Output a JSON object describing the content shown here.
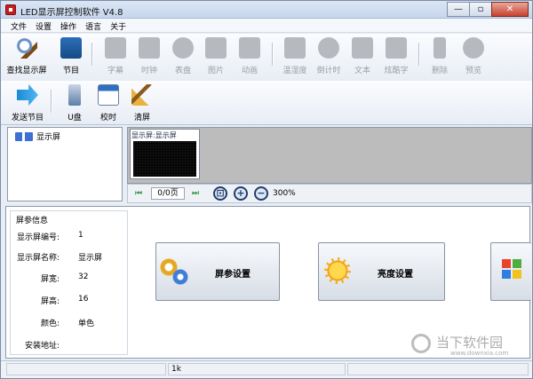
{
  "window": {
    "title": "LED显示屏控制软件  V4.8",
    "controls": [
      "—",
      "▫",
      "✕"
    ]
  },
  "menu": [
    "文件",
    "设置",
    "操作",
    "语言",
    "关于"
  ],
  "toolbar1": [
    {
      "label": "查找显示屏",
      "icon": "search-icon",
      "enabled": true
    },
    {
      "label": "节目",
      "icon": "program-icon",
      "enabled": true
    },
    {
      "label": "字幕",
      "icon": "subtitle-icon",
      "enabled": false
    },
    {
      "label": "时钟",
      "icon": "clock-icon",
      "enabled": false
    },
    {
      "label": "表盘",
      "icon": "dial-icon",
      "enabled": false
    },
    {
      "label": "图片",
      "icon": "image-icon",
      "enabled": false
    },
    {
      "label": "动画",
      "icon": "animation-icon",
      "enabled": false
    },
    {
      "label": "温湿度",
      "icon": "humidity-icon",
      "enabled": false
    },
    {
      "label": "倒计时",
      "icon": "countdown-icon",
      "enabled": false
    },
    {
      "label": "文本",
      "icon": "text-icon",
      "enabled": false
    },
    {
      "label": "炫酷字",
      "icon": "cool-text-icon",
      "enabled": false
    },
    {
      "label": "删除",
      "icon": "delete-icon",
      "enabled": false
    },
    {
      "label": "预览",
      "icon": "preview-icon",
      "enabled": false
    }
  ],
  "toolbar2": [
    {
      "label": "发送节目",
      "icon": "send-icon"
    },
    {
      "label": "U盘",
      "icon": "usb-icon"
    },
    {
      "label": "校时",
      "icon": "calendar-icon"
    },
    {
      "label": "清屏",
      "icon": "broom-icon"
    }
  ],
  "tree": {
    "root_label": "显示屏"
  },
  "preview": {
    "thumb_title": "显示屏:显示屏"
  },
  "nav": {
    "first": "⏮",
    "page": "0/0页",
    "last": "⏭",
    "zoom_pct": "300%"
  },
  "info": {
    "title": "屏参信息",
    "rows": [
      {
        "k": "显示屏编号:",
        "v": "1"
      },
      {
        "k": "显示屏名称:",
        "v": "显示屏"
      },
      {
        "k": "屏宽:",
        "v": "32"
      },
      {
        "k": "屏高:",
        "v": "16"
      },
      {
        "k": "颜色:",
        "v": "单色"
      },
      {
        "k": "安装地址:",
        "v": ""
      }
    ]
  },
  "actions": {
    "screen_params": "屏参设置",
    "brightness": "亮度设置"
  },
  "status": {
    "cell2": "1k"
  },
  "watermark": {
    "text": "当下软件园",
    "url": "www.downxia.com"
  }
}
